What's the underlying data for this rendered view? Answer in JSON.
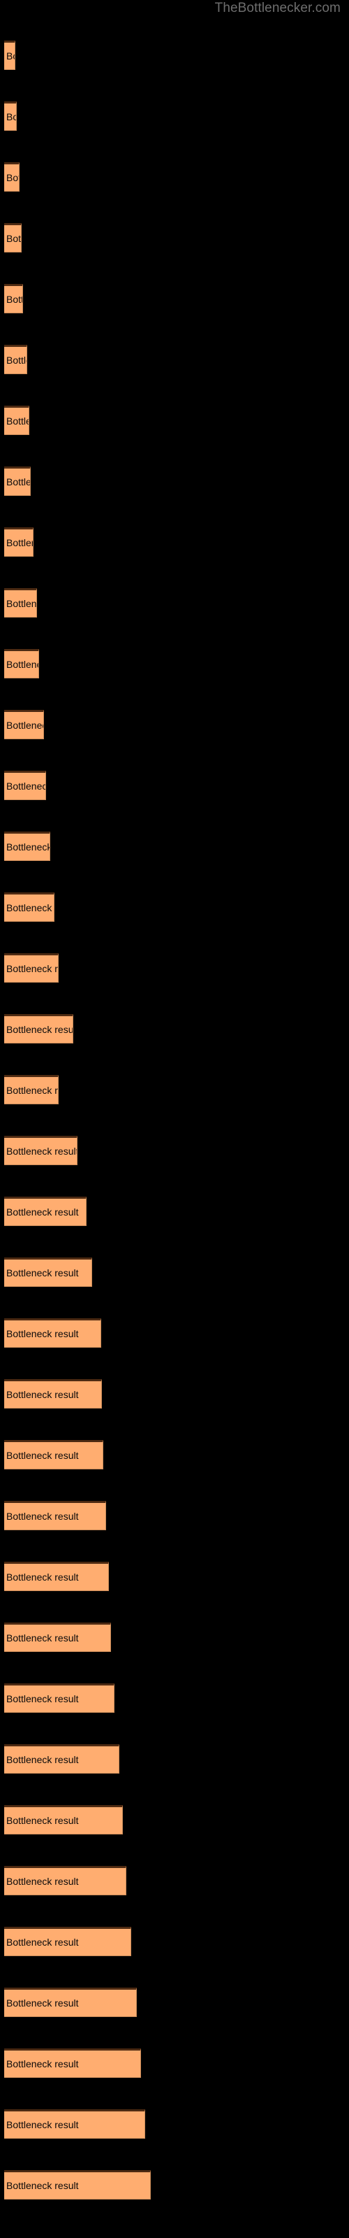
{
  "site": {
    "watermark": "TheBottlenecker.com"
  },
  "colors": {
    "background": "#000000",
    "bar_fill": "#ffad70",
    "bar_top_border": "#4d2a12",
    "bar_edge": "#c98a58",
    "label_text": "#0a0a0a",
    "watermark_text": "#6e6e6e"
  },
  "chart_data": {
    "type": "bar",
    "orientation": "horizontal",
    "title": "",
    "subtitle": "",
    "xlabel": "",
    "ylabel": "",
    "grid": false,
    "legend": null,
    "bar_label_text": "Bottleneck result",
    "xlim": [
      0,
      500
    ],
    "categories": [
      "Bottleneck result",
      "Bottleneck result",
      "Bottleneck result",
      "Bottleneck result",
      "Bottleneck result",
      "Bottleneck result",
      "Bottleneck result",
      "Bottleneck result",
      "Bottleneck result",
      "Bottleneck result",
      "Bottleneck result",
      "Bottleneck result",
      "Bottleneck result",
      "Bottleneck result",
      "Bottleneck result",
      "Bottleneck result",
      "Bottleneck result",
      "Bottleneck result",
      "Bottleneck result",
      "Bottleneck result",
      "Bottleneck result",
      "Bottleneck result",
      "Bottleneck result",
      "Bottleneck result",
      "Bottleneck result",
      "Bottleneck result",
      "Bottleneck result",
      "Bottleneck result",
      "Bottleneck result",
      "Bottleneck result",
      "Bottleneck result",
      "Bottleneck result",
      "Bottleneck result",
      "Bottleneck result",
      "Bottleneck result",
      "Bottleneck result"
    ],
    "values": [
      16,
      18,
      22,
      25,
      27,
      33,
      36,
      38,
      42,
      47,
      50,
      57,
      60,
      66,
      72,
      78,
      99,
      78,
      105,
      118,
      126,
      139,
      140,
      142,
      146,
      150,
      153,
      158,
      165,
      170,
      175,
      182,
      190,
      196,
      202,
      210
    ],
    "bars": [
      {
        "index": 1,
        "value": 16,
        "y": 58,
        "label": "Bottleneck result"
      },
      {
        "index": 2,
        "value": 18,
        "y": 145,
        "label": "Bottleneck result"
      },
      {
        "index": 3,
        "value": 22,
        "y": 232,
        "label": "Bottleneck result"
      },
      {
        "index": 4,
        "value": 25,
        "y": 319,
        "label": "Bottleneck result"
      },
      {
        "index": 5,
        "value": 27,
        "y": 406,
        "label": "Bottleneck result"
      },
      {
        "index": 6,
        "value": 33,
        "y": 493,
        "label": "Bottleneck result"
      },
      {
        "index": 7,
        "value": 36,
        "y": 580,
        "label": "Bottleneck result"
      },
      {
        "index": 8,
        "value": 38,
        "y": 667,
        "label": "Bottleneck result"
      },
      {
        "index": 9,
        "value": 42,
        "y": 754,
        "label": "Bottleneck result"
      },
      {
        "index": 10,
        "value": 47,
        "y": 841,
        "label": "Bottleneck result"
      },
      {
        "index": 11,
        "value": 50,
        "y": 928,
        "label": "Bottleneck result"
      },
      {
        "index": 12,
        "value": 57,
        "y": 1015,
        "label": "Bottleneck result"
      },
      {
        "index": 13,
        "value": 60,
        "y": 1102,
        "label": "Bottleneck result"
      },
      {
        "index": 14,
        "value": 66,
        "y": 1189,
        "label": "Bottleneck result"
      },
      {
        "index": 15,
        "value": 72,
        "y": 1276,
        "label": "Bottleneck result"
      },
      {
        "index": 16,
        "value": 78,
        "y": 1363,
        "label": "Bottleneck result"
      },
      {
        "index": 17,
        "value": 99,
        "y": 1450,
        "label": "Bottleneck result"
      },
      {
        "index": 18,
        "value": 78,
        "y": 1537,
        "label": "Bottleneck result"
      },
      {
        "index": 19,
        "value": 105,
        "y": 1624,
        "label": "Bottleneck result"
      },
      {
        "index": 20,
        "value": 118,
        "y": 1711,
        "label": "Bottleneck result"
      },
      {
        "index": 21,
        "value": 126,
        "y": 1798,
        "label": "Bottleneck result"
      },
      {
        "index": 22,
        "value": 139,
        "y": 1885,
        "label": "Bottleneck result"
      },
      {
        "index": 23,
        "value": 140,
        "y": 1972,
        "label": "Bottleneck result"
      },
      {
        "index": 24,
        "value": 142,
        "y": 2059,
        "label": "Bottleneck result"
      },
      {
        "index": 25,
        "value": 146,
        "y": 2146,
        "label": "Bottleneck result"
      },
      {
        "index": 26,
        "value": 150,
        "y": 2233,
        "label": "Bottleneck result"
      },
      {
        "index": 27,
        "value": 153,
        "y": 2320,
        "label": "Bottleneck result"
      },
      {
        "index": 28,
        "value": 158,
        "y": 2407,
        "label": "Bottleneck result"
      },
      {
        "index": 29,
        "value": 165,
        "y": 2494,
        "label": "Bottleneck result"
      },
      {
        "index": 30,
        "value": 170,
        "y": 2581,
        "label": "Bottleneck result"
      },
      {
        "index": 31,
        "value": 175,
        "y": 2668,
        "label": "Bottleneck result"
      },
      {
        "index": 32,
        "value": 182,
        "y": 2755,
        "label": "Bottleneck result"
      },
      {
        "index": 33,
        "value": 190,
        "y": 2842,
        "label": "Bottleneck result"
      },
      {
        "index": 34,
        "value": 196,
        "y": 2929,
        "label": "Bottleneck result"
      },
      {
        "index": 35,
        "value": 202,
        "y": 3016,
        "label": "Bottleneck result"
      },
      {
        "index": 36,
        "value": 210,
        "y": 3103,
        "label": "Bottleneck result"
      }
    ]
  }
}
